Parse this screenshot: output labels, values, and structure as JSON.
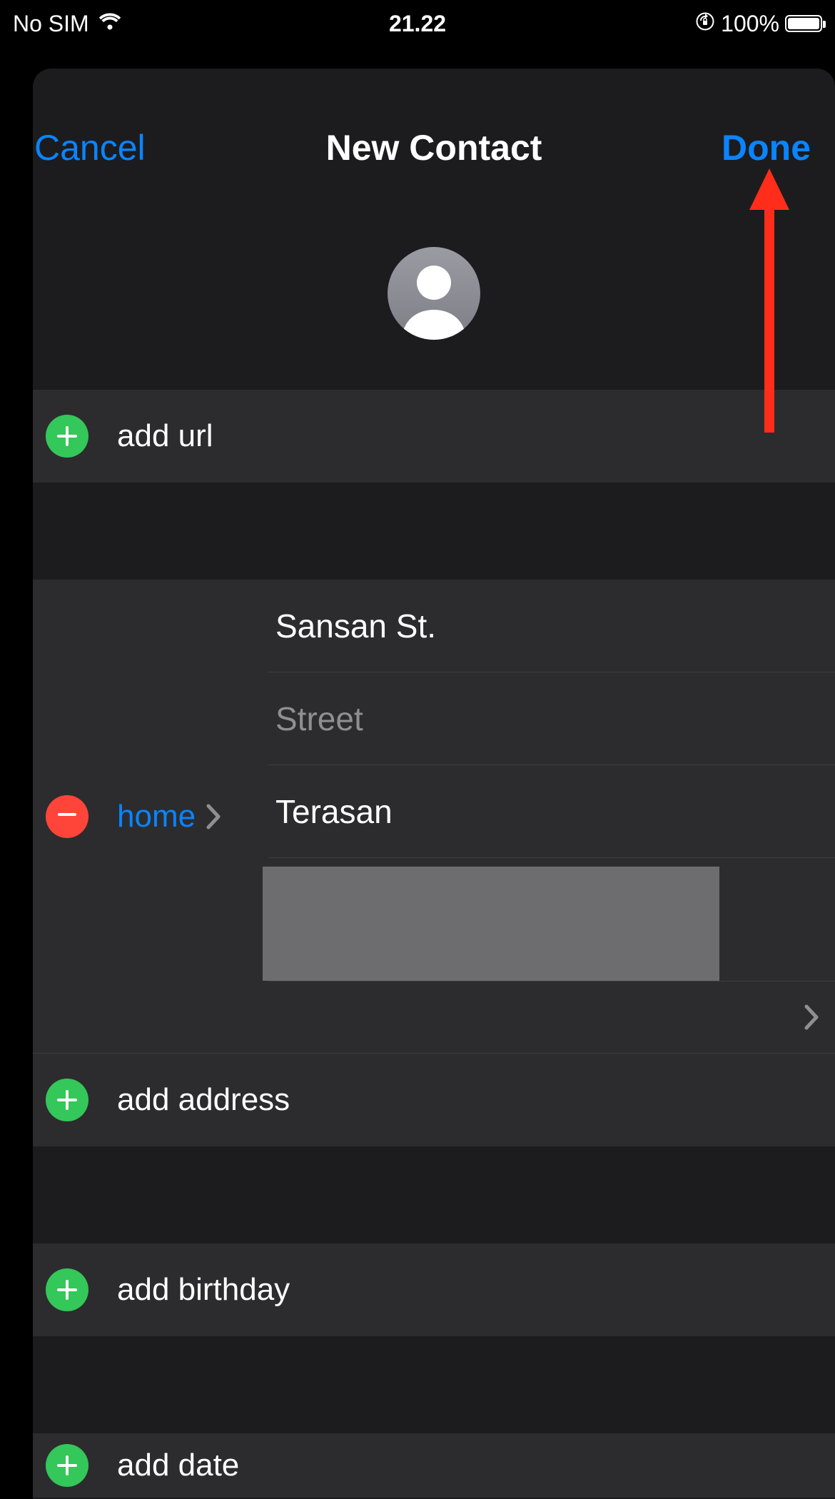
{
  "status_bar": {
    "carrier": "No SIM",
    "time": "21.22",
    "battery_pct": "100%"
  },
  "nav": {
    "cancel": "Cancel",
    "title": "New Contact",
    "done": "Done"
  },
  "colors": {
    "accent": "#0a84ff",
    "add": "#34c759",
    "remove": "#ff453a",
    "sheet_bg": "#1c1c1e",
    "row_bg": "#2c2c2e"
  },
  "url_section": {
    "add_label": "add url"
  },
  "address_section": {
    "type_label": "home",
    "street1_value": "Sansan St.",
    "street2_placeholder": "Street",
    "city_value": "Terasan",
    "add_label": "add address"
  },
  "birthday_section": {
    "add_label": "add birthday"
  },
  "date_section": {
    "add_label": "add date"
  }
}
